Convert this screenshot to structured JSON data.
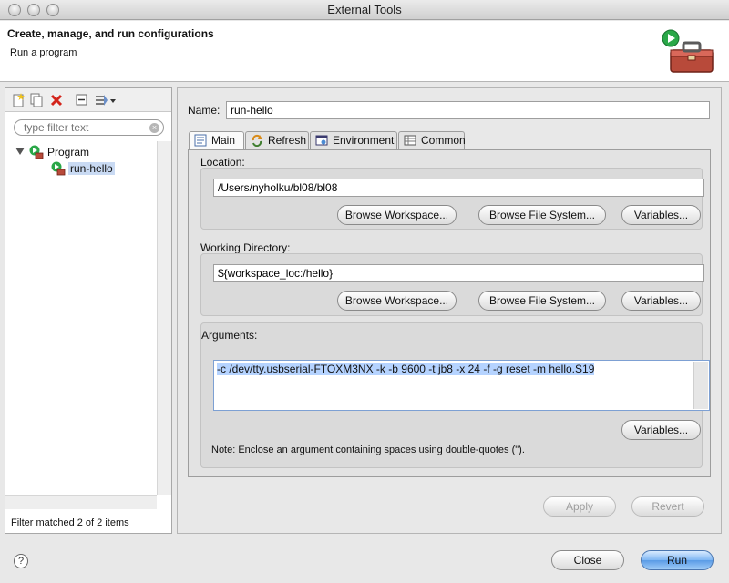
{
  "window": {
    "title": "External Tools"
  },
  "header": {
    "title": "Create, manage, and run configurations",
    "subtitle": "Run a program",
    "icon": "toolbox-run-icon"
  },
  "sidebar": {
    "toolbar_icons": [
      "new-config-icon",
      "duplicate-icon",
      "delete-icon",
      "collapse-all-icon",
      "filter-icon"
    ],
    "filter_placeholder": "type filter text",
    "tree": [
      {
        "label": "Program",
        "icon": "program-icon",
        "expanded": true,
        "children": [
          {
            "label": "run-hello",
            "icon": "program-config-icon",
            "selected": true
          }
        ]
      }
    ],
    "status": "Filter matched 2 of 2 items"
  },
  "main": {
    "name_label": "Name:",
    "name_value": "run-hello",
    "tabs": [
      {
        "label": "Main",
        "icon": "main-tab-icon",
        "active": true
      },
      {
        "label": "Refresh",
        "icon": "refresh-icon",
        "active": false
      },
      {
        "label": "Environment",
        "icon": "environment-icon",
        "active": false
      },
      {
        "label": "Common",
        "icon": "common-icon",
        "active": false
      }
    ],
    "location": {
      "label": "Location:",
      "value": "/Users/nyholku/bl08/bl08",
      "buttons": [
        "Browse Workspace...",
        "Browse File System...",
        "Variables..."
      ]
    },
    "working_directory": {
      "label": "Working Directory:",
      "value": "${workspace_loc:/hello}",
      "buttons": [
        "Browse Workspace...",
        "Browse File System...",
        "Variables..."
      ]
    },
    "arguments": {
      "label": "Arguments:",
      "value": "-c /dev/tty.usbserial-FTOXM3NX -k -b 9600 -t jb8 -x 24 -f -g reset -m hello.S19",
      "variables_button": "Variables...",
      "note": "Note: Enclose an argument containing spaces using double-quotes (\")."
    },
    "apply_label": "Apply",
    "revert_label": "Revert"
  },
  "footer": {
    "help_icon": "help-icon",
    "help_glyph": "?",
    "close_label": "Close",
    "run_label": "Run"
  }
}
